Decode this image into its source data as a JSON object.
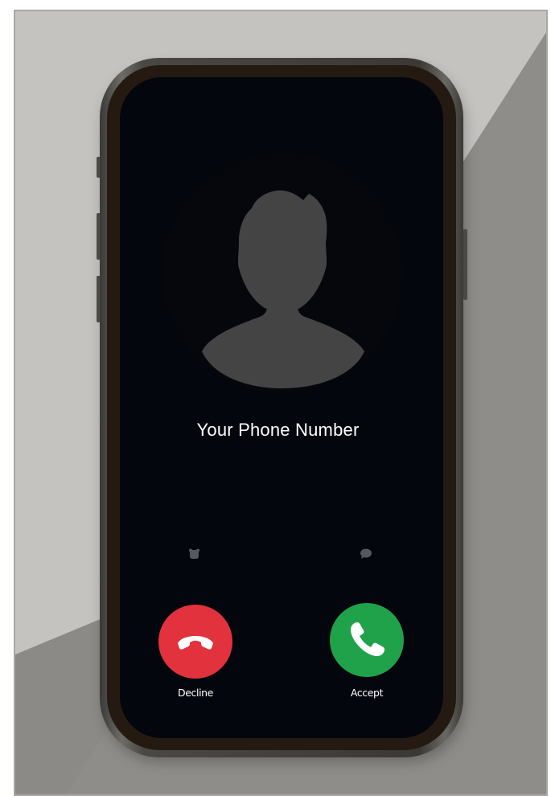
{
  "caller": {
    "name": "Your Phone Number"
  },
  "quick_actions": {
    "remind_icon": "alarm-clock-icon",
    "message_icon": "message-bubble-icon"
  },
  "actions": {
    "decline_label": "Decline",
    "accept_label": "Accept",
    "decline_icon": "phone-hangup-icon",
    "accept_icon": "phone-answer-icon"
  },
  "colors": {
    "decline": "#e2323e",
    "accept": "#1fa24a",
    "screen": "#03060c",
    "avatar_silhouette": "#444444"
  }
}
